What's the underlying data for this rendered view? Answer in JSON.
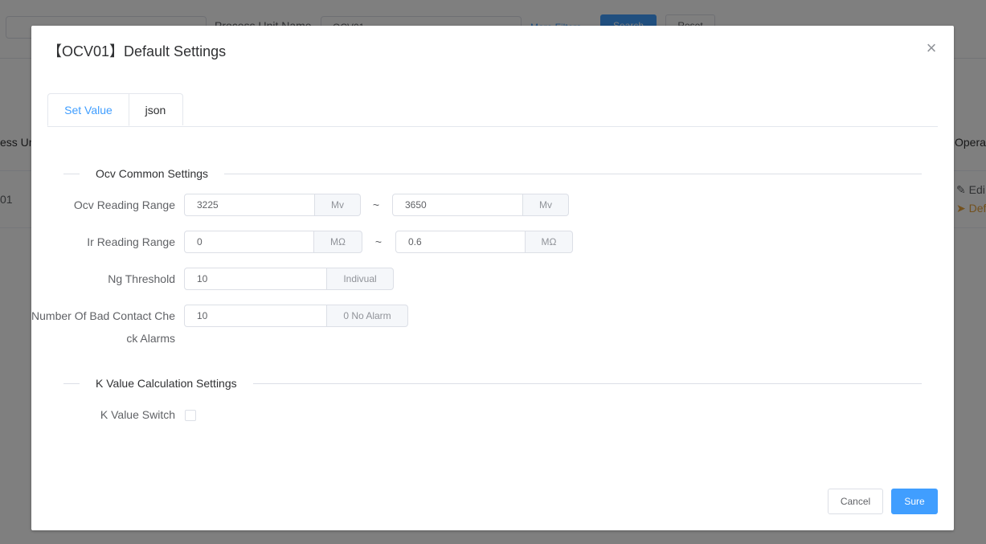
{
  "background": {
    "filter_label": "Process Unit Name",
    "filter_value": "OCV01",
    "more_filters": "More Filters",
    "search_button": "Search",
    "reset_button": "Reset",
    "table_header_left": "ess Un",
    "table_header_right": "Opera",
    "row_cell_left": "01",
    "row_op_edit": "Edi",
    "row_op_default": "Def"
  },
  "dialog": {
    "title": "【OCV01】Default Settings",
    "tabs": [
      {
        "label": "Set Value",
        "active": true
      },
      {
        "label": "json",
        "active": false
      }
    ],
    "sections": {
      "common": "Ocv Common Settings",
      "kvalue": "K Value Calculation Settings"
    },
    "fields": {
      "ocv_range": {
        "label": "Ocv Reading Range",
        "min": "3225",
        "min_unit": "Mv",
        "max": "3650",
        "max_unit": "Mv",
        "separator": "~"
      },
      "ir_range": {
        "label": "Ir Reading Range",
        "min": "0",
        "min_unit": "MΩ",
        "max": "0.6",
        "max_unit": "MΩ",
        "separator": "~"
      },
      "ng_threshold": {
        "label": "Ng Threshold",
        "value": "10",
        "unit": "Indivual"
      },
      "bad_contact": {
        "label": "Number Of Bad Contact Check Alarms",
        "value": "10",
        "unit": "0 No Alarm"
      },
      "k_switch": {
        "label": "K Value Switch",
        "checked": false
      }
    },
    "buttons": {
      "cancel": "Cancel",
      "sure": "Sure"
    }
  },
  "colors": {
    "primary": "#409eff",
    "warning": "#e6a23c",
    "overlay": "rgba(0,0,0,0.5)"
  }
}
